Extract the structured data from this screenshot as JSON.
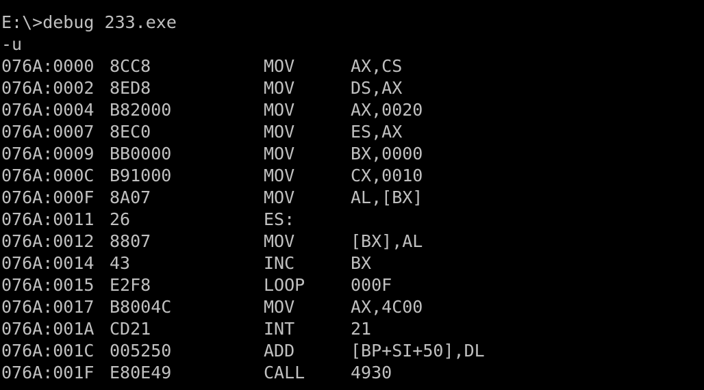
{
  "console": {
    "command": "E:\\>debug 233.exe",
    "prompt": "-u",
    "colors": {
      "background": "#000000",
      "text": "#c0c0c0"
    },
    "lines": [
      {
        "addr": "076A:0000",
        "hex": "8CC8",
        "mnemonic": "MOV",
        "operands": "AX,CS"
      },
      {
        "addr": "076A:0002",
        "hex": "8ED8",
        "mnemonic": "MOV",
        "operands": "DS,AX"
      },
      {
        "addr": "076A:0004",
        "hex": "B82000",
        "mnemonic": "MOV",
        "operands": "AX,0020"
      },
      {
        "addr": "076A:0007",
        "hex": "8EC0",
        "mnemonic": "MOV",
        "operands": "ES,AX"
      },
      {
        "addr": "076A:0009",
        "hex": "BB0000",
        "mnemonic": "MOV",
        "operands": "BX,0000"
      },
      {
        "addr": "076A:000C",
        "hex": "B91000",
        "mnemonic": "MOV",
        "operands": "CX,0010"
      },
      {
        "addr": "076A:000F",
        "hex": "8A07",
        "mnemonic": "MOV",
        "operands": "AL,[BX]"
      },
      {
        "addr": "076A:0011",
        "hex": "26",
        "mnemonic": "ES:",
        "operands": ""
      },
      {
        "addr": "076A:0012",
        "hex": "8807",
        "mnemonic": "MOV",
        "operands": "[BX],AL"
      },
      {
        "addr": "076A:0014",
        "hex": "43",
        "mnemonic": "INC",
        "operands": "BX"
      },
      {
        "addr": "076A:0015",
        "hex": "E2F8",
        "mnemonic": "LOOP",
        "operands": "000F"
      },
      {
        "addr": "076A:0017",
        "hex": "B8004C",
        "mnemonic": "MOV",
        "operands": "AX,4C00"
      },
      {
        "addr": "076A:001A",
        "hex": "CD21",
        "mnemonic": "INT",
        "operands": "21"
      },
      {
        "addr": "076A:001C",
        "hex": "005250",
        "mnemonic": "ADD",
        "operands": "[BP+SI+50],DL"
      },
      {
        "addr": "076A:001F",
        "hex": "E80E49",
        "mnemonic": "CALL",
        "operands": "4930"
      }
    ]
  }
}
